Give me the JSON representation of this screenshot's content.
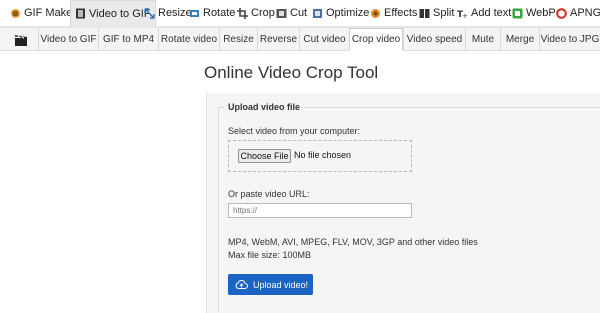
{
  "topnav": [
    {
      "label": "GIF Maker",
      "icon": "gif-maker-icon"
    },
    {
      "label": "Video to GIF",
      "icon": "video-to-gif-icon"
    },
    {
      "label": "Resize",
      "icon": "resize-icon"
    },
    {
      "label": "Rotate",
      "icon": "rotate-icon"
    },
    {
      "label": "Crop",
      "icon": "crop-icon"
    },
    {
      "label": "Cut",
      "icon": "cut-icon"
    },
    {
      "label": "Optimize",
      "icon": "optimize-icon"
    },
    {
      "label": "Effects",
      "icon": "effects-icon"
    },
    {
      "label": "Split",
      "icon": "split-icon"
    },
    {
      "label": "Add text",
      "icon": "add-text-icon"
    },
    {
      "label": "WebP",
      "icon": "webp-icon"
    },
    {
      "label": "APNG",
      "icon": "apng-icon"
    }
  ],
  "subnav": [
    "Video to GIF",
    "GIF to MP4",
    "Rotate video",
    "Resize",
    "Reverse",
    "Cut video",
    "Crop video",
    "Video speed",
    "Mute",
    "Merge",
    "Video to JPG"
  ],
  "page": {
    "title": "Online Video Crop Tool",
    "legend": "Upload video file",
    "select_label": "Select video from your computer:",
    "choose_file": "Choose File",
    "no_file": "No file chosen",
    "paste_label": "Or paste video URL:",
    "url_placeholder": "https://",
    "formats": "MP4, WebM, AVI, MPEG, FLV, MOV, 3GP and other video files",
    "max_size": "Max file size: 100MB",
    "upload_button": "Upload video!"
  },
  "colors": {
    "accent": "#1d63c4",
    "active_tab": "#e9e9e9"
  }
}
